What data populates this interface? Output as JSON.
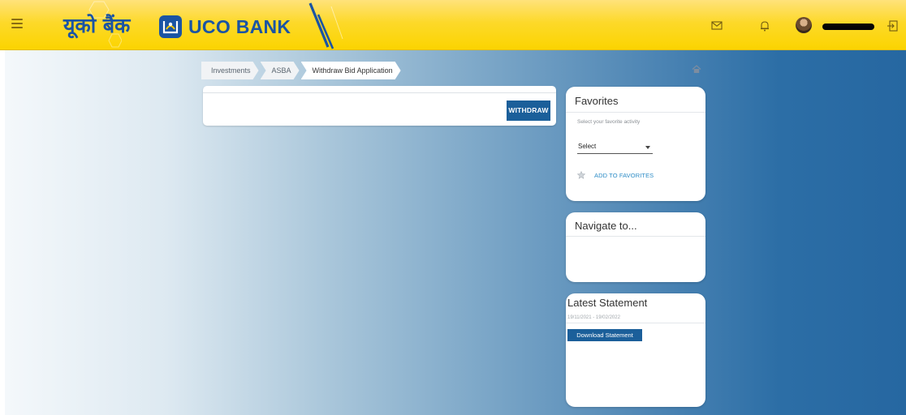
{
  "header": {
    "brand_hindi": "यूको बैंक",
    "brand_english": "UCO BANK",
    "icons": [
      "menu-icon",
      "mail-icon",
      "bell-icon",
      "logout-icon"
    ],
    "colors": {
      "header_yellow": "#fbd400",
      "brand_blue": "#1b54a3"
    }
  },
  "breadcrumb": {
    "items": [
      {
        "label": "Investments"
      },
      {
        "label": "ASBA"
      },
      {
        "label": "Withdraw Bid Application"
      }
    ]
  },
  "withdraw": {
    "button_label": "WITHDRAW"
  },
  "favorites": {
    "title": "Favorites",
    "hint": "Select your favorite activity",
    "select_value": "Select",
    "add_label": "ADD TO FAVORITES"
  },
  "navigate": {
    "title": "Navigate to..."
  },
  "statement": {
    "title": "Latest Statement",
    "date_range": "19/11/2021  -  19/02/2022",
    "download_label": "Download Statement"
  },
  "colors": {
    "primary_button": "#1b5f9a",
    "link_blue": "#2c8cc6"
  }
}
